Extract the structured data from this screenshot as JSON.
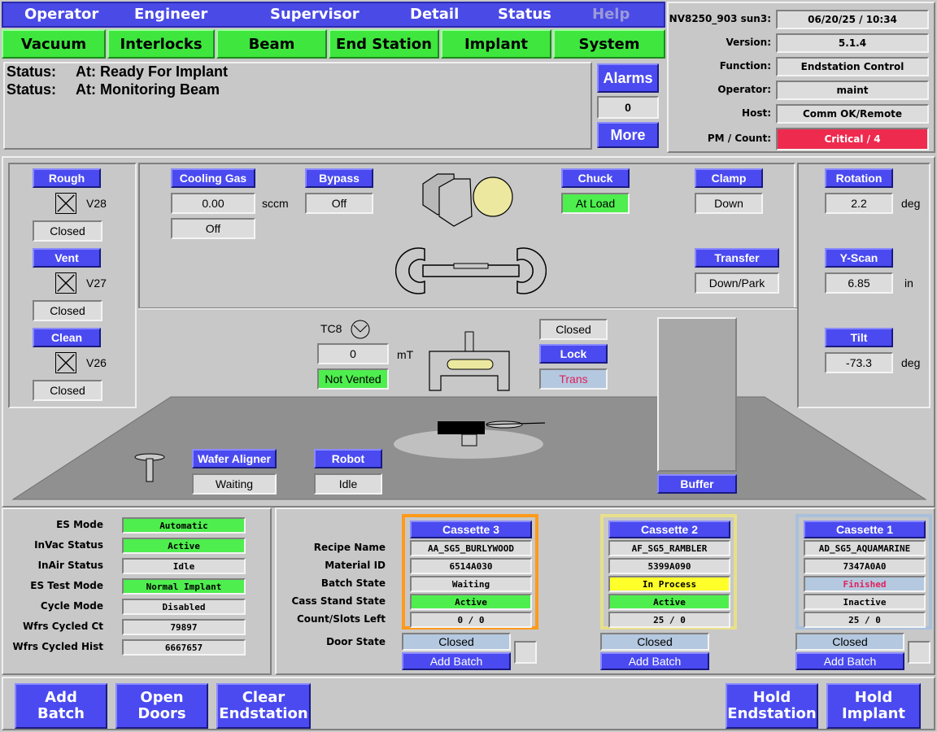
{
  "top_nav": {
    "tabs": [
      "Operator",
      "Engineer",
      "Supervisor",
      "Detail",
      "Status",
      "Help"
    ]
  },
  "subsystem_nav": {
    "tabs": [
      "Vacuum",
      "Interlocks",
      "Beam",
      "End Station",
      "Implant",
      "System"
    ]
  },
  "status": {
    "lines": [
      {
        "key": "Status:",
        "value": "At: Ready For Implant"
      },
      {
        "key": "Status:",
        "value": "At: Monitoring Beam"
      }
    ],
    "alarms_label": "Alarms",
    "alarm_count": "0",
    "more_label": "More"
  },
  "info": {
    "host_label": "NV8250_903 sun3:",
    "datetime": "06/20/25 / 10:34",
    "version_label": "Version:",
    "version": "5.1.4",
    "function_label": "Function:",
    "function": "Endstation Control",
    "operator_label": "Operator:",
    "operator": "maint",
    "host2_label": "Host:",
    "host": "Comm OK/Remote",
    "pm_label": "PM / Count:",
    "pm": "Critical / 4",
    "pm_color": "#ee2a4e"
  },
  "vacuum": {
    "rough_label": "Rough",
    "v28": "V28",
    "v28_state": "Closed",
    "vent_label": "Vent",
    "v27": "V27",
    "v27_state": "Closed",
    "clean_label": "Clean",
    "v26": "V26",
    "v26_state": "Closed"
  },
  "chamber": {
    "cooling_gas_label": "Cooling Gas",
    "cooling_gas_value": "0.00",
    "cooling_gas_unit": "sccm",
    "cooling_gas_state": "Off",
    "bypass_label": "Bypass",
    "bypass_state": "Off",
    "chuck_label": "Chuck",
    "chuck_state": "At Load",
    "clamp_label": "Clamp",
    "clamp_state": "Down",
    "transfer_label": "Transfer",
    "transfer_state": "Down/Park",
    "tc8_label": "TC8",
    "tc8_value": "0",
    "tc8_unit": "mT",
    "vent_state": "Not Vented",
    "door_state": "Closed",
    "lock_label": "Lock",
    "trans_label": "Trans",
    "wafer_aligner_label": "Wafer Aligner",
    "wafer_aligner_state": "Waiting",
    "robot_label": "Robot",
    "robot_state": "Idle",
    "buffer_label": "Buffer"
  },
  "motion": {
    "rotation_label": "Rotation",
    "rotation_value": "2.2",
    "rotation_unit": "deg",
    "yscan_label": "Y-Scan",
    "yscan_value": "6.85",
    "yscan_unit": "in",
    "tilt_label": "Tilt",
    "tilt_value": "-73.3",
    "tilt_unit": "deg"
  },
  "es_info": {
    "rows": [
      {
        "label": "ES Mode",
        "value": "Automatic",
        "color": "#4eee4e"
      },
      {
        "label": "InVac Status",
        "value": "Active",
        "color": "#4eee4e"
      },
      {
        "label": "InAir Status",
        "value": "Idle",
        "color": "#dcdcdc"
      },
      {
        "label": "ES Test Mode",
        "value": "Normal Implant",
        "color": "#4eee4e"
      },
      {
        "label": "Cycle Mode",
        "value": "Disabled",
        "color": "#dcdcdc"
      },
      {
        "label": "Wfrs Cycled Ct",
        "value": "79897",
        "color": "#dcdcdc"
      },
      {
        "label": "Wfrs Cycled Hist",
        "value": "6667657",
        "color": "#dcdcdc"
      }
    ]
  },
  "cassettes": {
    "row_labels": [
      "Recipe Name",
      "Material ID",
      "Batch State",
      "Cass Stand State",
      "Count/Slots Left",
      "Door State"
    ],
    "items": [
      {
        "name": "Cassette 3",
        "border": "#ff9a1a",
        "recipe": "AA_SG5_BURLYWOOD",
        "material": "6514A030",
        "batch": "Waiting",
        "batch_color": "#dcdcdc",
        "stand": "Active",
        "count": "0 / 0",
        "door": "Closed",
        "add_batch": "Add Batch"
      },
      {
        "name": "Cassette 2",
        "border": "#e8e08a",
        "recipe": "AF_SG5_RAMBLER",
        "material": "5399A090",
        "batch": "In Process",
        "batch_color": "#ffff2a",
        "stand": "Active",
        "count": "25 / 0",
        "door": "Closed",
        "add_batch": "Add Batch"
      },
      {
        "name": "Cassette 1",
        "border": "#a8c0dc",
        "recipe": "AD_SG5_AQUAMARINE",
        "material": "7347A0A0",
        "batch": "Finished",
        "batch_color": "#b4c8e0",
        "stand": "Inactive",
        "count": "25 / 0",
        "door": "Closed",
        "add_batch": "Add Batch"
      }
    ]
  },
  "bottom_buttons": {
    "add_batch": [
      "Add",
      "Batch"
    ],
    "open_doors": [
      "Open",
      "Doors"
    ],
    "clear_endstation": [
      "Clear",
      "Endstation"
    ],
    "hold_endstation": [
      "Hold",
      "Endstation"
    ],
    "hold_implant": [
      "Hold",
      "Implant"
    ]
  }
}
